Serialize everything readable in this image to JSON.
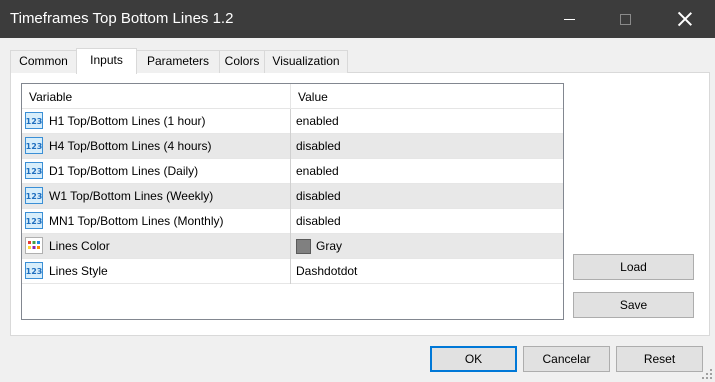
{
  "window": {
    "title": "Timeframes Top Bottom Lines 1.2"
  },
  "tabs": [
    {
      "label": "Common"
    },
    {
      "label": "Inputs"
    },
    {
      "label": "Parameters"
    },
    {
      "label": "Colors"
    },
    {
      "label": "Visualization"
    }
  ],
  "grid": {
    "header": {
      "variable": "Variable",
      "value": "Value"
    },
    "rows": [
      {
        "name": "H1 Top/Bottom Lines (1 hour)",
        "value": "enabled",
        "icon": "numeric-123-icon"
      },
      {
        "name": "H4 Top/Bottom Lines (4 hours)",
        "value": "disabled",
        "icon": "numeric-123-icon"
      },
      {
        "name": "D1 Top/Bottom Lines (Daily)",
        "value": "enabled",
        "icon": "numeric-123-icon"
      },
      {
        "name": "W1 Top/Bottom Lines (Weekly)",
        "value": "disabled",
        "icon": "numeric-123-icon"
      },
      {
        "name": "MN1 Top/Bottom Lines (Monthly)",
        "value": "disabled",
        "icon": "numeric-123-icon"
      },
      {
        "name": "Lines Color",
        "value": "Gray",
        "icon": "color-palette-icon",
        "swatch": "#808080"
      },
      {
        "name": "Lines Style",
        "value": "Dashdotdot",
        "icon": "numeric-123-icon"
      }
    ]
  },
  "side_buttons": {
    "load": "Load",
    "save": "Save"
  },
  "footer_buttons": {
    "ok": "OK",
    "cancel": "Cancelar",
    "reset": "Reset"
  },
  "colors": {
    "accent": "#0078d7",
    "titlebar": "#3c3c3c"
  }
}
